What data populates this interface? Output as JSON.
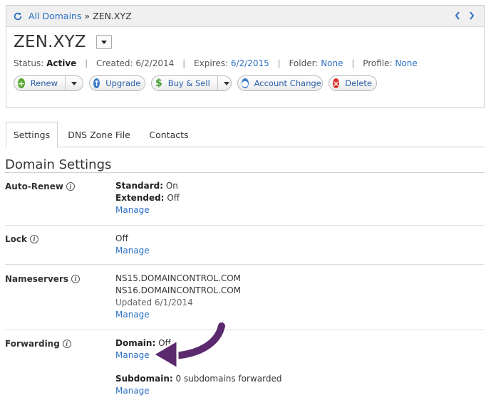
{
  "breadcrumb": {
    "root": "All Domains",
    "separator": "»",
    "current": "ZEN.XYZ"
  },
  "domain": {
    "title": "ZEN.XYZ"
  },
  "status": {
    "status_label": "Status:",
    "status_value": "Active",
    "created_label": "Created:",
    "created_value": "6/2/2014",
    "expires_label": "Expires:",
    "expires_value": "6/2/2015",
    "folder_label": "Folder:",
    "folder_value": "None",
    "profile_label": "Profile:",
    "profile_value": "None"
  },
  "actions": {
    "renew": "Renew",
    "upgrade": "Upgrade",
    "buy_sell": "Buy & Sell",
    "account_change": "Account Change",
    "delete": "Delete"
  },
  "tabs": [
    {
      "label": "Settings",
      "active": true
    },
    {
      "label": "DNS Zone File",
      "active": false
    },
    {
      "label": "Contacts",
      "active": false
    }
  ],
  "section": {
    "title": "Domain Settings"
  },
  "settings": {
    "auto_renew": {
      "label": "Auto-Renew",
      "standard_label": "Standard:",
      "standard_value": "On",
      "extended_label": "Extended:",
      "extended_value": "Off",
      "manage": "Manage"
    },
    "lock": {
      "label": "Lock",
      "value": "Off",
      "manage": "Manage"
    },
    "nameservers": {
      "label": "Nameservers",
      "ns1": "NS15.DOMAINCONTROL.COM",
      "ns2": "NS16.DOMAINCONTROL.COM",
      "updated": "Updated 6/1/2014",
      "manage": "Manage"
    },
    "forwarding": {
      "label": "Forwarding",
      "domain_label": "Domain:",
      "domain_value": "Off",
      "manage": "Manage",
      "subdomain_label": "Subdomain:",
      "subdomain_value": "0 subdomains forwarded",
      "subdomain_manage": "Manage"
    }
  },
  "colors": {
    "link": "#2a6fc1",
    "arrow": "#5b2a6e"
  }
}
